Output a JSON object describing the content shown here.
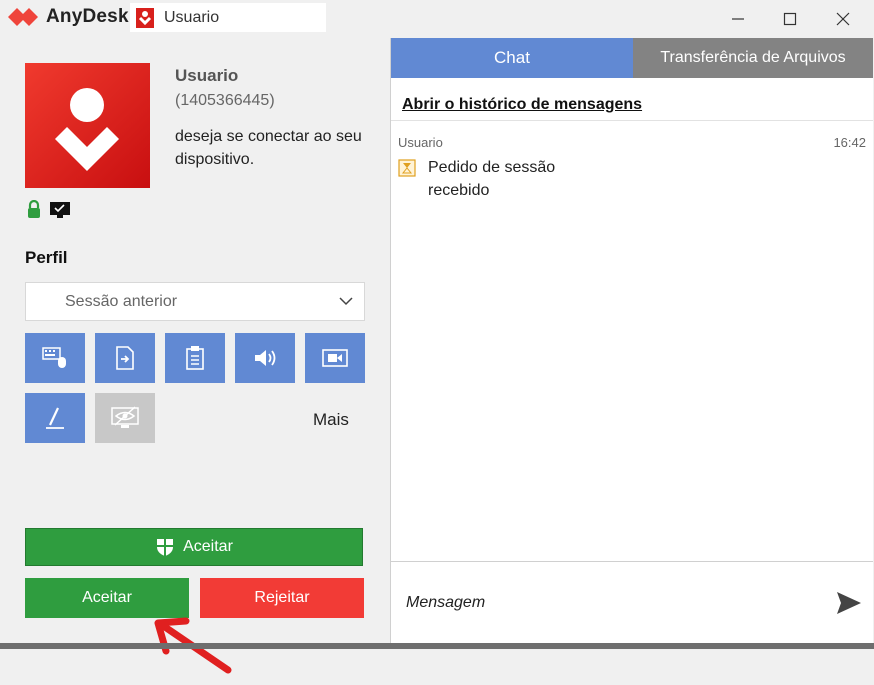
{
  "app": {
    "name": "AnyDesk",
    "brand_color": "#ef443b"
  },
  "session_tab": {
    "label": "Usuario",
    "icon": "anydesk-user-icon"
  },
  "window_controls": {
    "minimize": "minimize-icon",
    "maximize": "maximize-icon",
    "close": "close-icon"
  },
  "request": {
    "user_name": "Usuario",
    "user_id": "(1405366445)",
    "message": "deseja se conectar ao seu dispositivo.",
    "status_icons": [
      "lock-icon",
      "monitor-icon"
    ]
  },
  "profile": {
    "label": "Perfil",
    "selected": "Sessão anterior"
  },
  "permissions": [
    {
      "name": "keyboard-mouse-icon",
      "enabled": true
    },
    {
      "name": "file-manager-icon",
      "enabled": true
    },
    {
      "name": "clipboard-icon",
      "enabled": true
    },
    {
      "name": "sound-icon",
      "enabled": true
    },
    {
      "name": "record-session-icon",
      "enabled": true
    },
    {
      "name": "draw-icon",
      "enabled": true
    },
    {
      "name": "privacy-mode-icon",
      "enabled": false
    }
  ],
  "more_label": "Mais",
  "buttons": {
    "accept_wide": "Aceitar",
    "accept": "Aceitar",
    "reject": "Rejeitar"
  },
  "colors": {
    "accent": "#6189d3",
    "accept": "#2f9d3f",
    "reject": "#f23b36"
  },
  "chat": {
    "tabs": [
      "Chat",
      "Transferência de Arquivos"
    ],
    "history_link": "Abrir o histórico de mensagens",
    "message": {
      "sender": "Usuario",
      "time": "16:42",
      "text": "Pedido de sessão recebido"
    },
    "input_placeholder": "Mensagem"
  }
}
